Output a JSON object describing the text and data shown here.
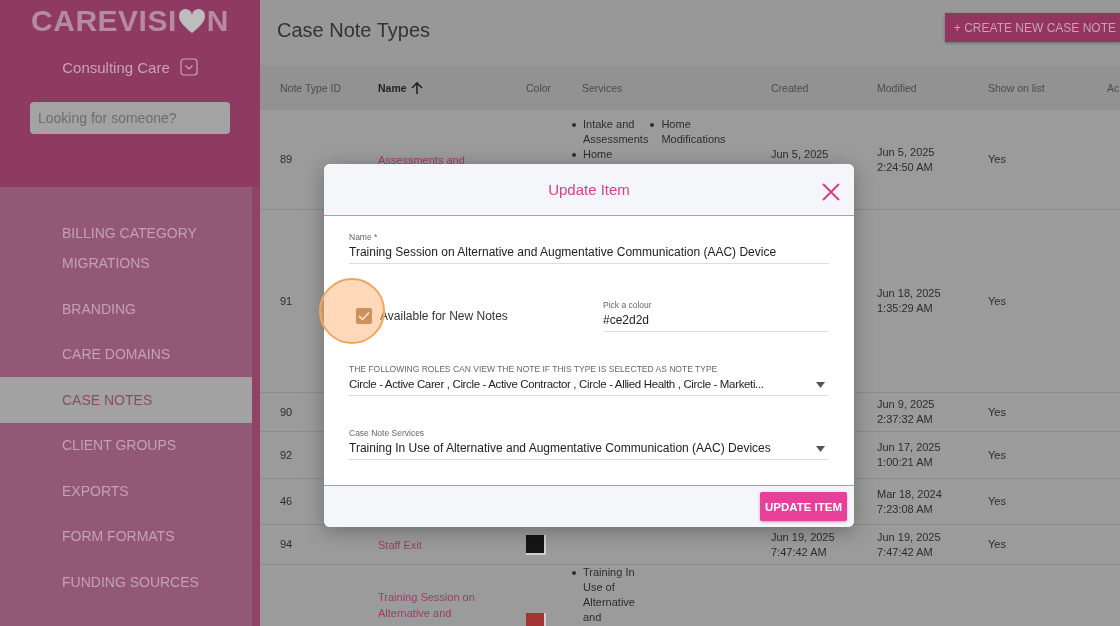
{
  "sidebar": {
    "logo": {
      "before": "CAREVISI",
      "after": "N"
    },
    "organization": "Consulting Care",
    "search": {
      "placeholder": "Looking for someone?"
    },
    "items": [
      {
        "label": "BILLING CATEGORY MIGRATIONS",
        "selected": false
      },
      {
        "label": "BRANDING",
        "selected": false
      },
      {
        "label": "CARE DOMAINS",
        "selected": false
      },
      {
        "label": "CASE NOTES",
        "selected": true
      },
      {
        "label": "CLIENT GROUPS",
        "selected": false
      },
      {
        "label": "EXPORTS",
        "selected": false
      },
      {
        "label": "FORM FORMATS",
        "selected": false
      },
      {
        "label": "FUNDING SOURCES",
        "selected": false
      }
    ]
  },
  "page": {
    "title": "Case Note Types",
    "create_button": "+ CREATE NEW CASE NOTE"
  },
  "table": {
    "columns": [
      {
        "label": "Note Type ID",
        "sorted": false
      },
      {
        "label": "Name",
        "sorted": true
      },
      {
        "label": "Color",
        "sorted": false
      },
      {
        "label": "Services",
        "sorted": false
      },
      {
        "label": "Created",
        "sorted": false
      },
      {
        "label": "Modified",
        "sorted": false
      },
      {
        "label": "Show on list",
        "sorted": false
      },
      {
        "label": "Ac",
        "sorted": false
      }
    ],
    "rows": [
      {
        "id": "89",
        "name": [
          "Assessments and"
        ],
        "services": [
          [
            "Intake and",
            "Assessments"
          ],
          [
            "Home",
            "Modifications"
          ],
          [
            "Home"
          ]
        ],
        "created": [
          "Jun 5, 2025"
        ],
        "modified": [
          "Jun 5, 2025",
          "2:24:50 AM"
        ],
        "show": "Yes"
      },
      {
        "id": "91",
        "modified": [
          "Jun 18, 2025",
          "1:35:29 AM"
        ],
        "show": "Yes"
      },
      {
        "id": "90",
        "modified": [
          "Jun 9, 2025",
          "2:37:32 AM"
        ],
        "show": "Yes"
      },
      {
        "id": "92",
        "modified": [
          "Jun 17, 2025",
          "1:00:21 AM"
        ],
        "show": "Yes"
      },
      {
        "id": "46",
        "modified": [
          "Mar 18, 2024",
          "7:23:08 AM"
        ],
        "show": "Yes"
      },
      {
        "id": "94",
        "name": [
          "Staff Exit"
        ],
        "color": "#151515",
        "created": [
          "Jun 19, 2025",
          "7:47:42 AM"
        ],
        "modified": [
          "Jun 19, 2025",
          "7:47:42 AM"
        ],
        "show": "Yes"
      },
      {
        "name": [
          "Training Session on",
          "Alternative and"
        ],
        "color": "#a33535",
        "services": [
          [
            "Training In",
            "Use of",
            "Alternative",
            "and"
          ]
        ]
      }
    ]
  },
  "modal": {
    "title": "Update Item",
    "name": {
      "label": "Name *",
      "value": "Training Session on Alternative and Augmentative Communication (AAC) Device"
    },
    "available": {
      "label": "Available for New Notes",
      "checked": true
    },
    "colour": {
      "label": "Pick a colour",
      "value": "#ce2d2d"
    },
    "roles": {
      "label": "THE FOLLOWING ROLES CAN VIEW THE NOTE IF THIS TYPE IS SELECTED AS NOTE TYPE",
      "value": "Circle - Active Carer , Circle - Active Contractor , Circle - Allied Health , Circle - Marketi..."
    },
    "services": {
      "label": "Case Note Services",
      "value": "Training In Use of Alternative and Augmentative Communication (AAC) Devices"
    },
    "button": "UPDATE ITEM"
  }
}
